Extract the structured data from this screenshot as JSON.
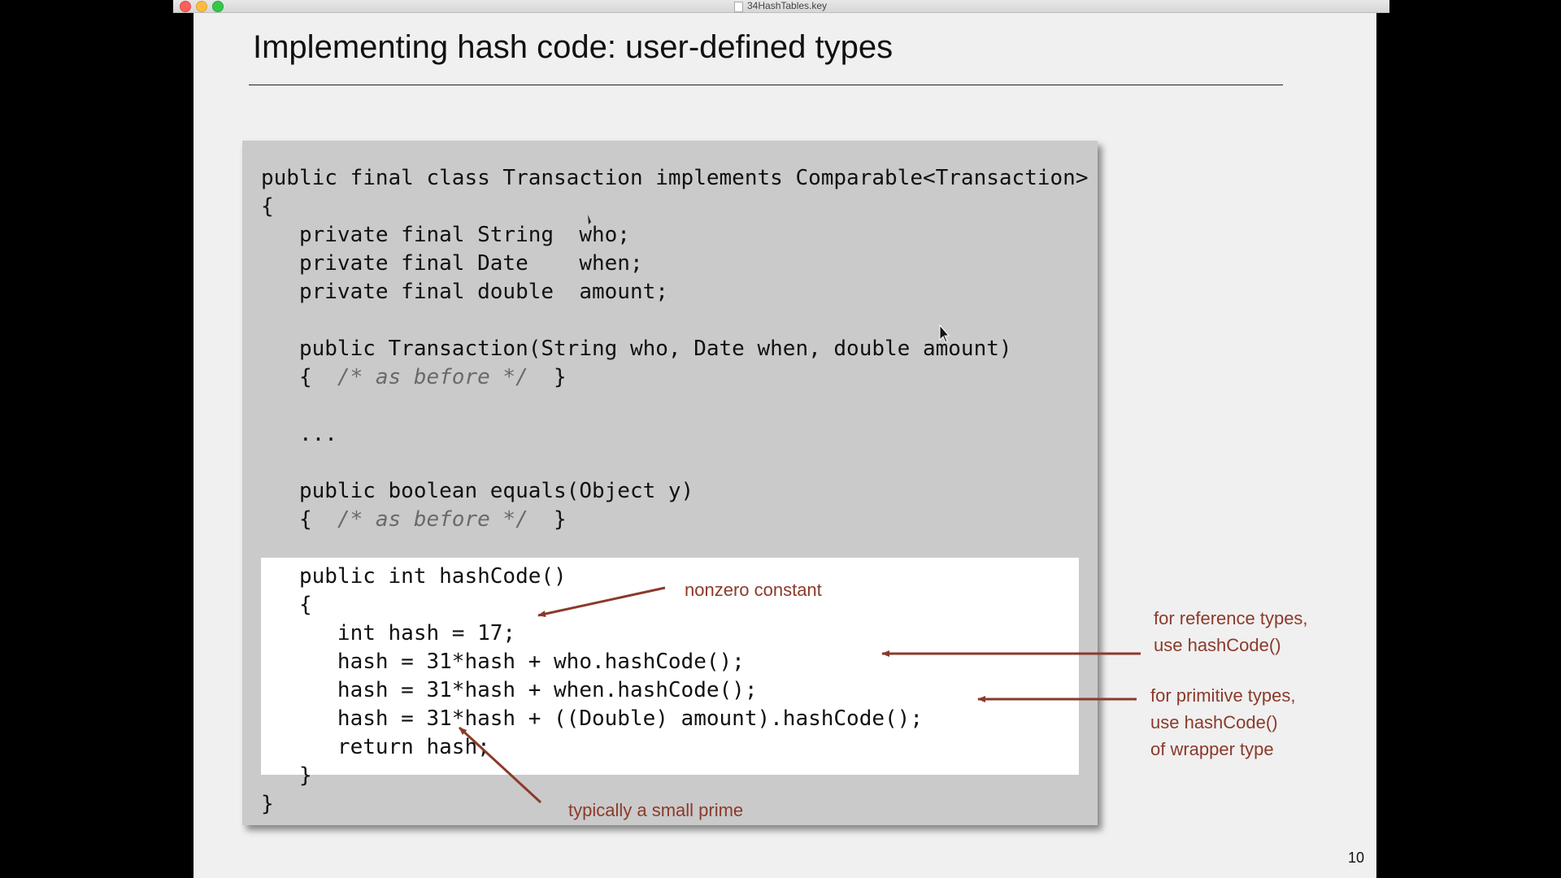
{
  "window": {
    "title": "34HashTables.key"
  },
  "slide": {
    "title": "Implementing hash code:  user-defined types",
    "page_number": "10",
    "code": {
      "lines": [
        "public final class Transaction implements Comparable<Transaction>",
        "{",
        "   private final String  who;",
        "   private final Date    when;",
        "   private final double  amount;",
        "   public Transaction(String who, Date when, double amount)",
        "   {  ",
        "/* as before */",
        "  }",
        "   ...",
        "   public boolean equals(Object y)",
        "   {  ",
        "/* as before */",
        "  }",
        "   public int hashCode()",
        "   {",
        "      int hash = 17;",
        "      hash = 31*hash + who.hashCode();",
        "      hash = 31*hash + when.hashCode();",
        "      hash = 31*hash + ((Double) amount).hashCode();",
        "      return hash;",
        "   }",
        "}"
      ]
    },
    "annotations": {
      "nonzero": "nonzero constant",
      "reference_line1": "for reference types,",
      "reference_line2": "use hashCode()",
      "primitive_line1": "for primitive types,",
      "primitive_line2": "use hashCode()",
      "primitive_line3": "of wrapper type",
      "prime": "typically a small prime"
    },
    "colors": {
      "annotation": "#8b3a2a",
      "panel": "#cacaca",
      "highlight": "#ffffff"
    }
  }
}
